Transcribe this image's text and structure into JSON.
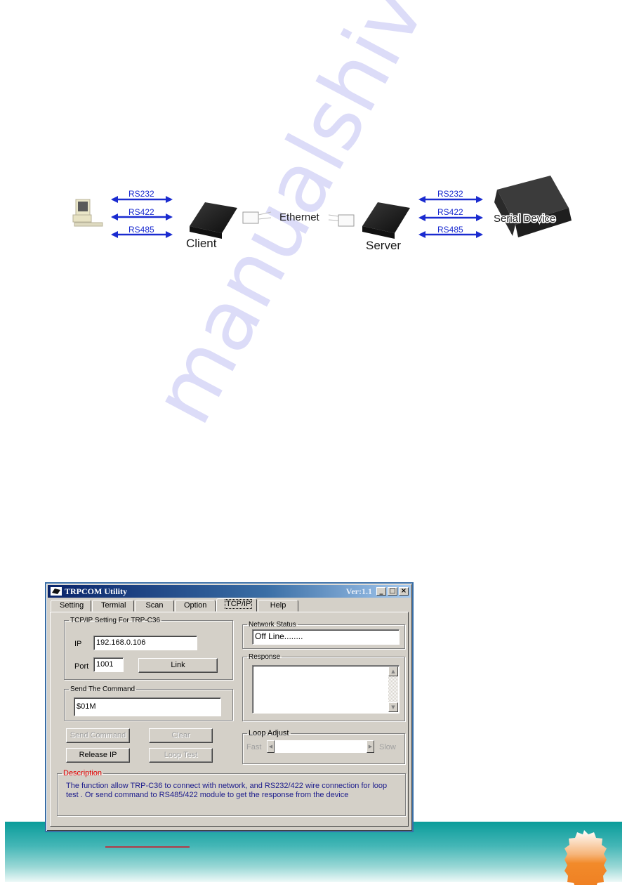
{
  "watermark": "manualshive.com",
  "diagram": {
    "pc_label": "",
    "client_label": "Client",
    "server_label": "Server",
    "ethernet_label": "Ethernet",
    "serial_device_label": "Serial Device",
    "left_links": [
      "RS232",
      "RS422",
      "RS485"
    ],
    "right_links": [
      "RS232",
      "RS422",
      "RS485"
    ],
    "arrow_color": "#1a2bd0"
  },
  "window": {
    "title": "TRPCOM Utility",
    "version": "Ver:1.1",
    "controls": {
      "minimize": "_",
      "maximize": "□",
      "close": "×"
    },
    "tabs": [
      {
        "label": "Setting",
        "active": false
      },
      {
        "label": "Termial",
        "active": false
      },
      {
        "label": "Scan",
        "active": false
      },
      {
        "label": "Option",
        "active": false
      },
      {
        "label": "TCP/IP",
        "active": true
      },
      {
        "label": "Help",
        "active": false
      }
    ],
    "tcpip_group": {
      "legend": "TCP/IP Setting For TRP-C36",
      "ip_label": "IP",
      "ip_value": "192.168.0.106",
      "port_label": "Port",
      "port_value": "1001",
      "link_button": "Link"
    },
    "command_group": {
      "legend": "Send The Command",
      "command_value": "$01M"
    },
    "buttons": {
      "send_command": "Send Command",
      "clear": "Clear",
      "release_ip": "Release IP",
      "loop_test": "Loop Test"
    },
    "network_status": {
      "legend": "Network Status",
      "value": "Off Line........"
    },
    "response": {
      "legend": "Response",
      "value": ""
    },
    "loop_adjust": {
      "legend": "Loop Adjust",
      "min_label": "Fast",
      "max_label": "Slow"
    },
    "description": {
      "legend": "Description",
      "text": "The function allow TRP-C36 to connect with network, and RS232/422 wire connection for loop test . Or send command to RS485/422  module  to get the response from the device"
    },
    "colors": {
      "title_bar": "#0a246a",
      "face": "#d4d0c8",
      "description_legend": "#e00000",
      "description_text": "#1c1c8c"
    }
  },
  "footer": {
    "band_color": "#0a9c9a",
    "badge_color": "#f28a2a"
  }
}
